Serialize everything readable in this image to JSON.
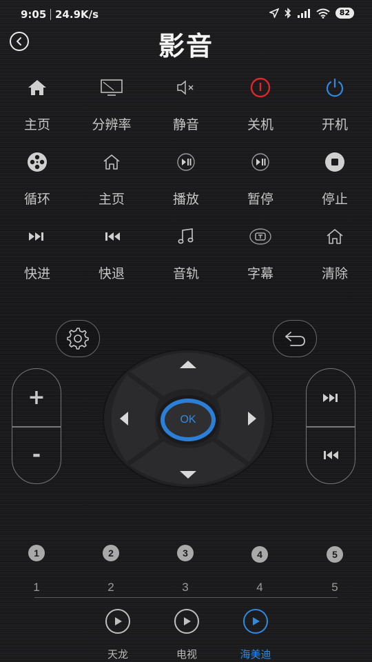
{
  "status_bar": {
    "time": "9:05",
    "speed": "24.9K/s",
    "battery": "82"
  },
  "header": {
    "title": "影音",
    "back_icon": "chevron-left-circle-icon"
  },
  "functions": {
    "row1": [
      {
        "label": "主页",
        "icon": "home-filled-icon"
      },
      {
        "label": "分辨率",
        "icon": "monitor-icon"
      },
      {
        "label": "静音",
        "icon": "mute-icon"
      },
      {
        "label": "关机",
        "icon": "power-red-icon"
      },
      {
        "label": "开机",
        "icon": "power-blue-icon"
      }
    ],
    "row2": [
      {
        "label": "循环",
        "icon": "reel-icon"
      },
      {
        "label": "主页",
        "icon": "home-outline-icon"
      },
      {
        "label": "播放",
        "icon": "play-pause-icon"
      },
      {
        "label": "暂停",
        "icon": "play-pause-icon"
      },
      {
        "label": "停止",
        "icon": "stop-icon"
      }
    ],
    "row3": [
      {
        "label": "快进",
        "icon": "fast-forward-icon"
      },
      {
        "label": "快退",
        "icon": "rewind-icon"
      },
      {
        "label": "音轨",
        "icon": "music-note-icon"
      },
      {
        "label": "字幕",
        "icon": "subtitle-icon"
      },
      {
        "label": "清除",
        "icon": "home-outline-icon"
      }
    ]
  },
  "controls": {
    "volume_up": "+",
    "volume_down": "-",
    "ok_label": "OK",
    "accent_color": "#2c7fd6"
  },
  "numbers": [
    {
      "badge": "1",
      "label": "1"
    },
    {
      "badge": "2",
      "label": "2"
    },
    {
      "badge": "3",
      "label": "3"
    },
    {
      "badge": "4",
      "label": "4"
    },
    {
      "badge": "5",
      "label": "5"
    }
  ],
  "tabs": [
    {
      "label": "天龙",
      "active": false
    },
    {
      "label": "电视",
      "active": false
    },
    {
      "label": "海美迪",
      "active": true
    }
  ]
}
